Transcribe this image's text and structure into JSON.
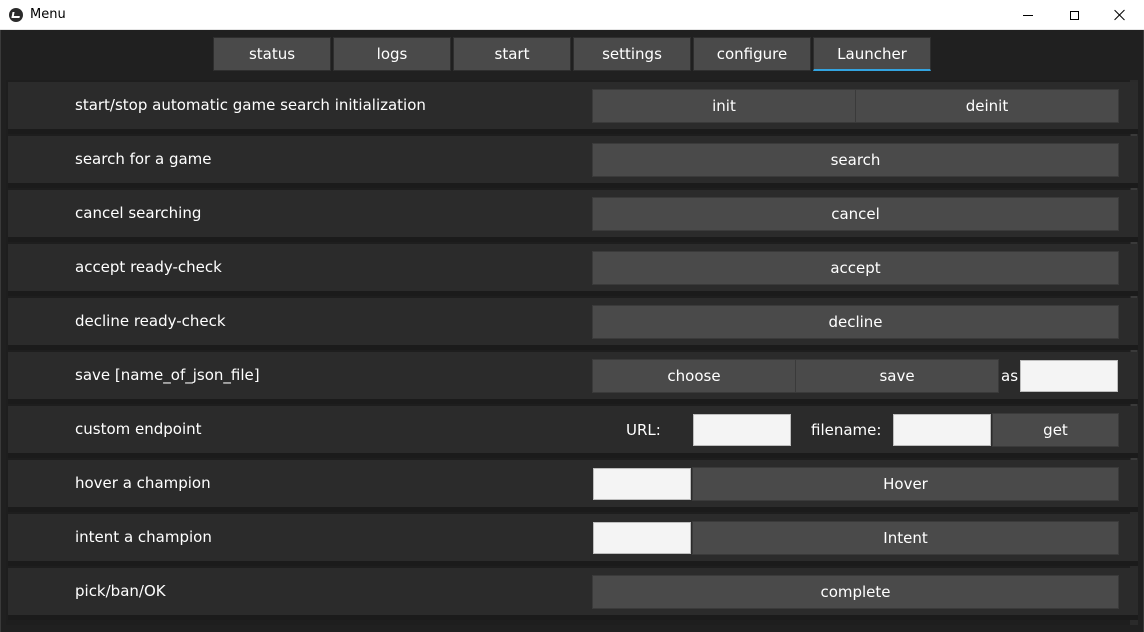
{
  "window": {
    "title": "Menu"
  },
  "tabs": [
    {
      "label": "status"
    },
    {
      "label": "logs"
    },
    {
      "label": "start"
    },
    {
      "label": "settings"
    },
    {
      "label": "configure"
    },
    {
      "label": "Launcher",
      "active": true
    }
  ],
  "rows": [
    {
      "label": "start/stop automatic game search initialization",
      "buttons": [
        "init",
        "deinit"
      ]
    },
    {
      "label": "search for a game",
      "buttons": [
        "search"
      ]
    },
    {
      "label": "cancel searching",
      "buttons": [
        "cancel"
      ]
    },
    {
      "label": "accept ready-check",
      "buttons": [
        "accept"
      ]
    },
    {
      "label": "decline ready-check",
      "buttons": [
        "decline"
      ]
    },
    {
      "label": "save [name_of_json_file]",
      "buttons": [
        "choose",
        "save"
      ],
      "suffix": "as",
      "input_value": ""
    },
    {
      "label": "custom endpoint",
      "url_label": "URL:",
      "url_value": "",
      "filename_label": "filename:",
      "filename_value": "",
      "button": "get"
    },
    {
      "label": "hover a champion",
      "input_value": "",
      "button": "Hover"
    },
    {
      "label": "intent a champion",
      "input_value": "",
      "button": "Intent"
    },
    {
      "label": "pick/ban/OK",
      "buttons": [
        "complete"
      ]
    }
  ],
  "colors": {
    "accent": "#33a4e0",
    "button": "#4a4a4a",
    "row": "#2b2b2b",
    "background": "#202020"
  }
}
